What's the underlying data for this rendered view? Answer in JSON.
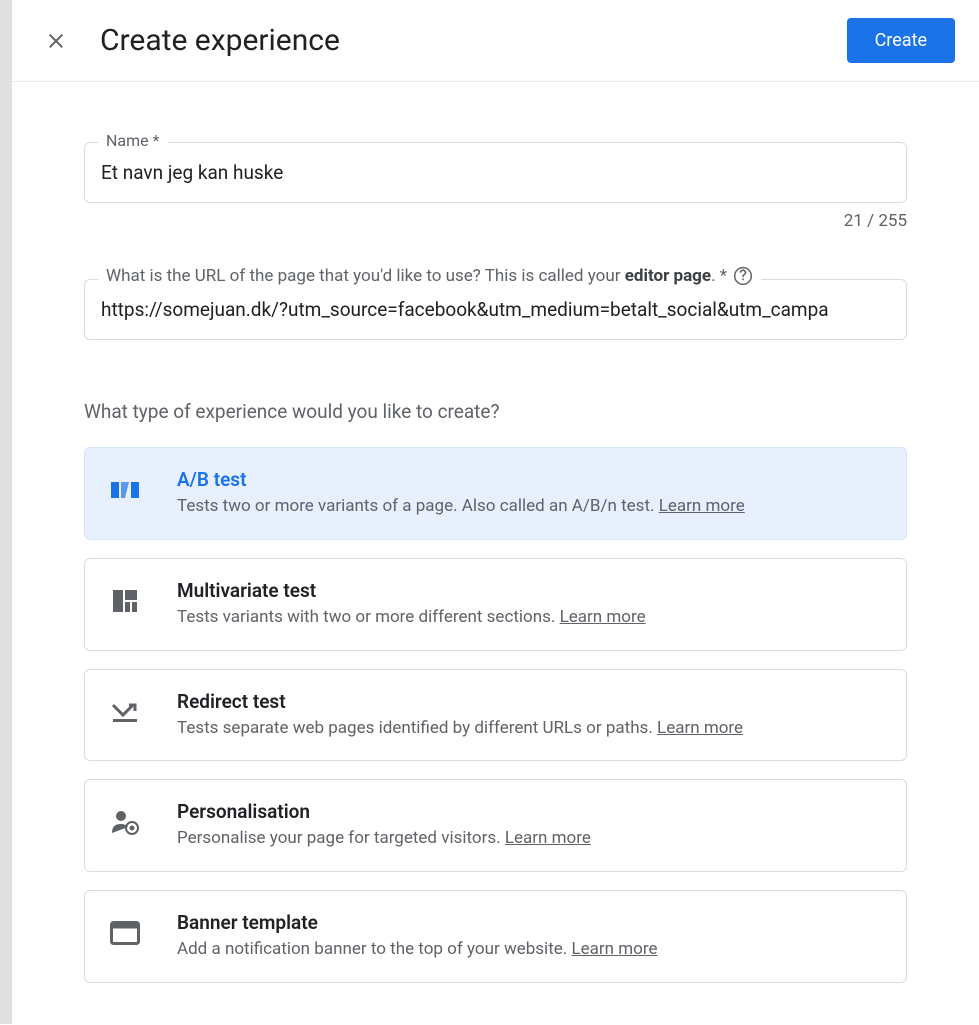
{
  "header": {
    "title": "Create experience",
    "create_button": "Create"
  },
  "form": {
    "name_label": "Name *",
    "name_value": "Et navn jeg kan huske",
    "char_counter": "21 / 255",
    "url_label_prefix": "What is the URL of the page that you'd like to use? This is called your ",
    "url_label_bold": "editor page",
    "url_label_suffix": ". *",
    "url_value": "https://somejuan.dk/?utm_source=facebook&utm_medium=betalt_social&utm_campa"
  },
  "section": {
    "heading": "What type of experience would you like to create?"
  },
  "options": [
    {
      "title": "A/B test",
      "description": "Tests two or more variants of a page. Also called an A/B/n test. ",
      "learn_more": "Learn more",
      "selected": true
    },
    {
      "title": "Multivariate test",
      "description": "Tests variants with two or more different sections. ",
      "learn_more": "Learn more",
      "selected": false
    },
    {
      "title": "Redirect test",
      "description": "Tests separate web pages identified by different URLs or paths. ",
      "learn_more": "Learn more",
      "selected": false
    },
    {
      "title": "Personalisation",
      "description": "Personalise your page for targeted visitors. ",
      "learn_more": "Learn more",
      "selected": false
    },
    {
      "title": "Banner template",
      "description": "Add a notification banner to the top of your website. ",
      "learn_more": "Learn more",
      "selected": false
    }
  ]
}
